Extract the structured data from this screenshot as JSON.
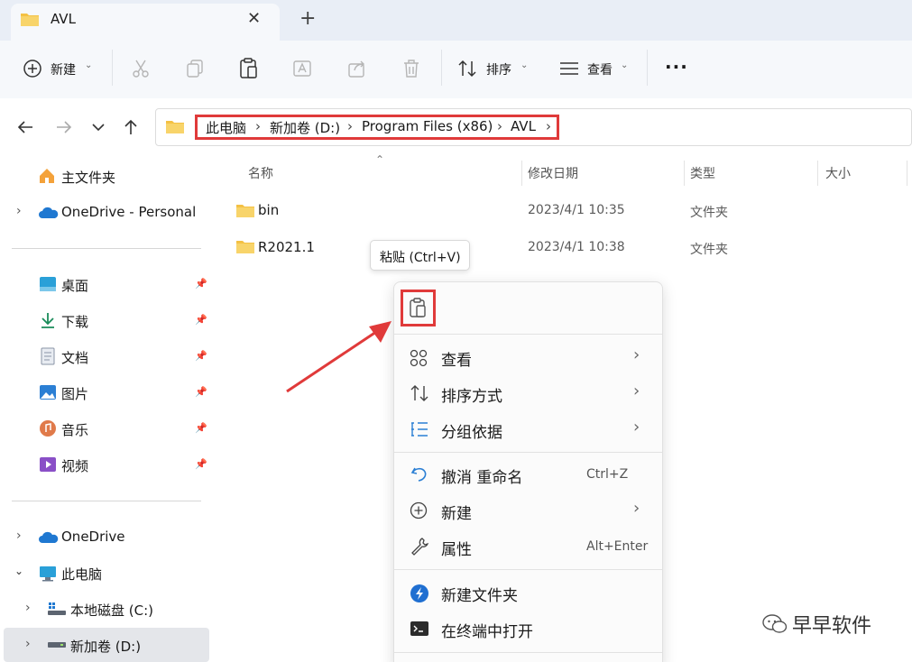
{
  "tab": {
    "title": "AVL",
    "close_glyph": "✕",
    "new_tab_glyph": "+"
  },
  "toolbar": {
    "new_label": "新建",
    "sort_label": "排序",
    "view_label": "查看",
    "more_glyph": "···"
  },
  "address": {
    "crumbs": [
      "此电脑",
      "新加卷 (D:)",
      "Program Files (x86)",
      "AVL"
    ]
  },
  "sidebar": {
    "home": "主文件夹",
    "onedrive_personal": "OneDrive - Personal",
    "quick_access": [
      "桌面",
      "下载",
      "文档",
      "图片",
      "音乐",
      "视频"
    ],
    "onedrive": "OneDrive",
    "this_pc": "此电脑",
    "drive_c": "本地磁盘 (C:)",
    "drive_d": "新加卷 (D:)"
  },
  "columns": {
    "name": "名称",
    "modified": "修改日期",
    "type": "类型",
    "size": "大小"
  },
  "files": [
    {
      "name": "bin",
      "modified": "2023/4/1 10:35",
      "type": "文件夹"
    },
    {
      "name": "R2021.1",
      "modified": "2023/4/1 10:38",
      "type": "文件夹"
    }
  ],
  "tooltip": "粘贴 (Ctrl+V)",
  "context_menu": {
    "view": "查看",
    "sort": "排序方式",
    "group": "分组依据",
    "undo": "撤消 重命名",
    "undo_shortcut": "Ctrl+Z",
    "new": "新建",
    "properties": "属性",
    "properties_shortcut": "Alt+Enter",
    "new_folder": "新建文件夹",
    "open_terminal": "在终端中打开",
    "chevron": "›"
  },
  "watermark": "早早软件",
  "colors": {
    "accent_red": "#e03a3a",
    "folder_yellow": "#f4c144",
    "selected_bg": "#e4e6ea"
  }
}
